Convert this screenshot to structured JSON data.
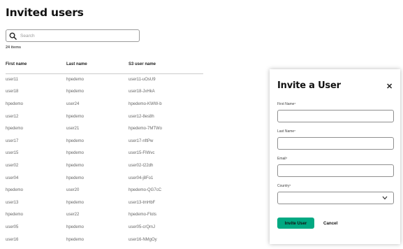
{
  "page": {
    "title": "Invited users"
  },
  "search": {
    "placeholder": "Search"
  },
  "item_count": "24 items",
  "table": {
    "headers": [
      "First name",
      "Last name",
      "S3 user name"
    ],
    "rows": [
      [
        "user11",
        "hpedemo",
        "user11-uOsU9"
      ],
      [
        "user18",
        "hpedemo",
        "user18-JxHkA"
      ],
      [
        "hpedemo",
        "user24",
        "hpedemo-KWW-b"
      ],
      [
        "user12",
        "hpedemo",
        "user12-8es8h"
      ],
      [
        "hpedemo",
        "user21",
        "hpedemo-7MTWo"
      ],
      [
        "user17",
        "hpedemo",
        "user17-nftPw"
      ],
      [
        "user15",
        "hpedemo",
        "user15-FIWvc"
      ],
      [
        "user02",
        "hpedemo",
        "user02-t22dh"
      ],
      [
        "user04",
        "hpedemo",
        "user04-j8Fo1"
      ],
      [
        "hpedemo",
        "user20",
        "hpedemo-QG7cC"
      ],
      [
        "user13",
        "hpedemo",
        "user13-tmHbF"
      ],
      [
        "hpedemo",
        "user22",
        "hpedemo-Flots"
      ],
      [
        "user05",
        "hpedemo",
        "user05-crQmJ"
      ],
      [
        "user16",
        "hpedemo",
        "user16-NMgOy"
      ]
    ]
  },
  "modal": {
    "title": "Invite a User",
    "close_icon": "close-icon",
    "fields": {
      "first_name": "First Name",
      "last_name": "Last Name",
      "email": "Email",
      "country": "Country"
    },
    "required_mark": "*",
    "invite_label": "Invite User",
    "cancel_label": "Cancel"
  },
  "colors": {
    "accent": "#01a982"
  }
}
